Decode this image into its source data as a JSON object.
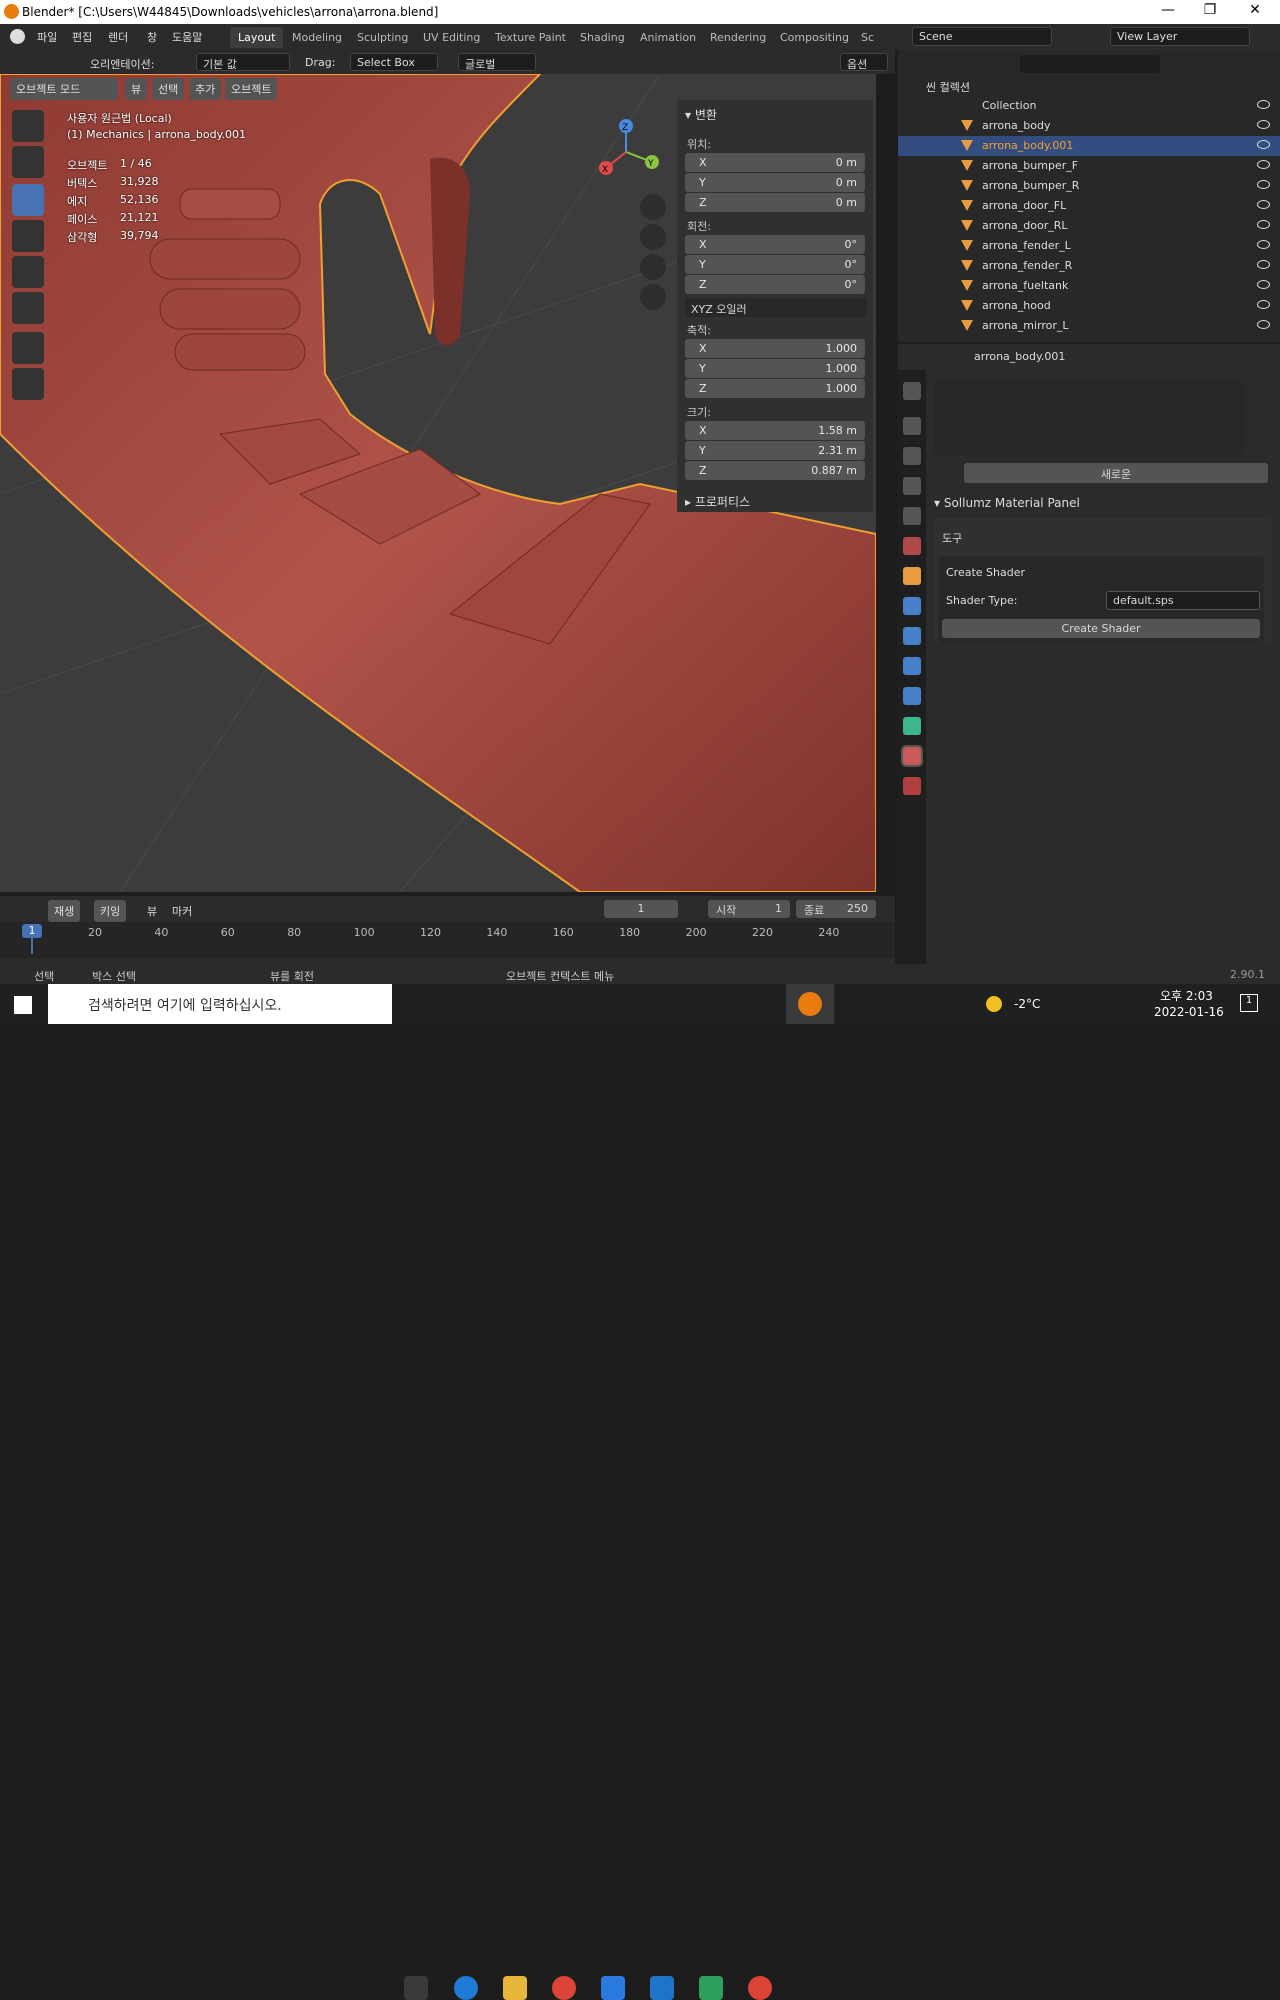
{
  "window": {
    "title": "Blender* [C:\\Users\\W44845\\Downloads\\vehicles\\arrona\\arrona.blend]"
  },
  "menu": [
    "파일",
    "편집",
    "렌더",
    "창",
    "도움말"
  ],
  "workspaces": [
    "Layout",
    "Modeling",
    "Sculpting",
    "UV Editing",
    "Texture Paint",
    "Shading",
    "Animation",
    "Rendering",
    "Compositing",
    "Sc"
  ],
  "scene": {
    "scene_name": "Scene",
    "view_layer": "View Layer"
  },
  "header": {
    "orientation_label": "오리엔테이션:",
    "orientation_value": "기본 값",
    "drag_label": "Drag:",
    "drag_value": "Select Box",
    "transform_space": "글로벌",
    "options": "옵션"
  },
  "viewport_header": {
    "mode": "오브젝트 모드",
    "view": "뷰",
    "select": "선택",
    "add": "추가",
    "object": "오브젝트"
  },
  "viewport_info": {
    "view_name": "사용자 원근법 (Local)",
    "collection": "(1) Mechanics | arrona_body.001",
    "stats": [
      {
        "label": "오브젝트",
        "value": "1 / 46"
      },
      {
        "label": "버텍스",
        "value": "31,928"
      },
      {
        "label": "에지",
        "value": "52,136"
      },
      {
        "label": "페이스",
        "value": "21,121"
      },
      {
        "label": "삼각형",
        "value": "39,794"
      }
    ]
  },
  "gizmo": {
    "x": "X",
    "y": "Y",
    "z": "Z"
  },
  "transform_panel": {
    "title": "변환",
    "location_label": "위치:",
    "location": [
      {
        "axis": "X",
        "value": "0 m"
      },
      {
        "axis": "Y",
        "value": "0 m"
      },
      {
        "axis": "Z",
        "value": "0 m"
      }
    ],
    "rotation_label": "회전:",
    "rotation": [
      {
        "axis": "X",
        "value": "0°"
      },
      {
        "axis": "Y",
        "value": "0°"
      },
      {
        "axis": "Z",
        "value": "0°"
      }
    ],
    "rotation_mode": "XYZ 오일러",
    "scale_label": "축적:",
    "scale": [
      {
        "axis": "X",
        "value": "1.000"
      },
      {
        "axis": "Y",
        "value": "1.000"
      },
      {
        "axis": "Z",
        "value": "1.000"
      }
    ],
    "dimensions_label": "크기:",
    "dimensions": [
      {
        "axis": "X",
        "value": "1.58 m"
      },
      {
        "axis": "Y",
        "value": "2.31 m"
      },
      {
        "axis": "Z",
        "value": "0.887 m"
      }
    ],
    "properties_label": "프로퍼티스"
  },
  "outliner": {
    "scene_collection": "씬 컬렉션",
    "collection": "Collection",
    "items": [
      {
        "name": "arrona_body",
        "selected": false
      },
      {
        "name": "arrona_body.001",
        "selected": true
      },
      {
        "name": "arrona_bumper_F",
        "selected": false
      },
      {
        "name": "arrona_bumper_R",
        "selected": false
      },
      {
        "name": "arrona_door_FL",
        "selected": false
      },
      {
        "name": "arrona_door_RL",
        "selected": false
      },
      {
        "name": "arrona_fender_L",
        "selected": false
      },
      {
        "name": "arrona_fender_R",
        "selected": false
      },
      {
        "name": "arrona_fueltank",
        "selected": false
      },
      {
        "name": "arrona_hood",
        "selected": false
      },
      {
        "name": "arrona_mirror_L",
        "selected": false
      }
    ]
  },
  "properties": {
    "object_name": "arrona_body.001",
    "new_button": "새로운",
    "panel_title": "Sollumz Material Panel",
    "tools_label": "도구",
    "create_shader_heading": "Create Shader",
    "shader_type_label": "Shader Type:",
    "shader_type_value": "default.sps",
    "create_shader_button": "Create Shader"
  },
  "timeline": {
    "playback": "재생",
    "keying": "키잉",
    "view": "뷰",
    "marker": "마커",
    "current_frame": "1",
    "start_label": "시작",
    "start": "1",
    "end_label": "종료",
    "end": "250",
    "ticks": [
      "20",
      "40",
      "60",
      "80",
      "100",
      "120",
      "140",
      "160",
      "180",
      "200",
      "220",
      "240"
    ],
    "cursor": "1"
  },
  "statusbar": {
    "select": "선택",
    "box_select": "박스 선택",
    "rotate": "뷰를 회전",
    "context_menu": "오브젝트 컨텍스트 메뉴",
    "version": "2.90.1"
  },
  "taskbar": {
    "search_placeholder": "검색하려면 여기에 입력하십시오.",
    "weather": "-2°C",
    "time": "오후 2:03",
    "date": "2022-01-16",
    "notifications": "1"
  },
  "colors": {
    "accent": "#4772b3",
    "selection": "#e89c3f",
    "model": "#a8473f",
    "header": "#2b2b2b"
  }
}
